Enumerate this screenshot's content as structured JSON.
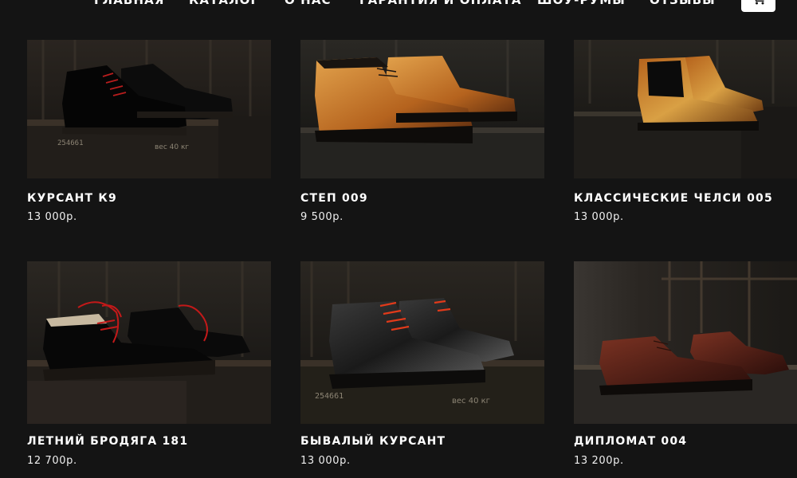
{
  "nav": {
    "items": [
      {
        "label": "ГЛАВНАЯ"
      },
      {
        "label": "КАТАЛОГ"
      },
      {
        "label": "О НАС"
      },
      {
        "label": "ГАРАНТИЯ И ОПЛАТА"
      },
      {
        "label": "ШОУ-РУМЫ"
      },
      {
        "label": "ОТЗЫВЫ"
      }
    ],
    "cart_icon": "shopping-cart-icon"
  },
  "products": [
    {
      "name": "КУРСАНТ К9",
      "price": "13 000р.",
      "photo": "black-derby-boots-on-crate"
    },
    {
      "name": "СТЕП 009",
      "price": "9 500р.",
      "photo": "tan-chukka-boots-on-crate"
    },
    {
      "name": "КЛАССИЧЕСКИЕ ЧЕЛСИ 005",
      "price": "13 000р.",
      "photo": "tan-chelsea-boots-on-crate"
    },
    {
      "name": "ЛЕТНИЙ БРОДЯГА 181",
      "price": "12 700р.",
      "photo": "black-shoes-red-laces-on-crate"
    },
    {
      "name": "БЫВАЛЫЙ КУРСАНТ",
      "price": "13 000р.",
      "photo": "grey-boots-red-laces-on-crate"
    },
    {
      "name": "ДИПЛОМАТ 004",
      "price": "13 200р.",
      "photo": "burgundy-oxfords-on-crate"
    }
  ],
  "crate_stencil": {
    "number": "254661",
    "weight": "вес 40 кг"
  },
  "colors": {
    "background": "#141414",
    "text": "#ffffff",
    "cart_button": "#ffffff"
  }
}
